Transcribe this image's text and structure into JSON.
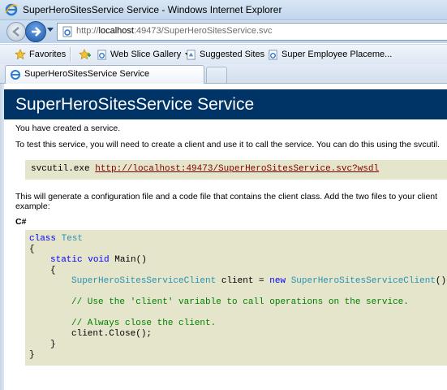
{
  "window": {
    "title": "SuperHeroSitesService Service - Windows Internet Explorer"
  },
  "address": {
    "prefix": "http://",
    "host": "localhost",
    "rest": ":49473/SuperHeroSitesService.svc"
  },
  "favorites_bar": {
    "favorites_label": "Favorites",
    "items": [
      {
        "label": "Web Slice Gallery",
        "icon": "web-slice-icon",
        "has_dropdown": true
      },
      {
        "label": "Suggested Sites",
        "icon": "suggested-sites-icon",
        "has_dropdown": true
      },
      {
        "label": "Super Employee Placeme...",
        "icon": "ie-page-icon",
        "has_dropdown": false
      }
    ]
  },
  "tabs": [
    {
      "label": "SuperHeroSitesService Service",
      "active": true
    }
  ],
  "page": {
    "heading": "SuperHeroSitesService Service",
    "created_msg": "You have created a service.",
    "test_msg": "To test this service, you will need to create a client and use it to call the service. You can do this using the svcutil.",
    "command": {
      "tool": "svcutil.exe",
      "url": "http://localhost:49473/SuperHeroSitesService.svc?wsdl"
    },
    "generate_msg_line1": "This will generate a configuration file and a code file that contains the client class. Add the two files to your client",
    "generate_msg_line2": "example:",
    "lang_label": "C#",
    "code": {
      "l1_kw": "class",
      "l1_cls": "Test",
      "l2": "{",
      "l3_kw1": "static",
      "l3_kw2": "void",
      "l3_rest": "Main()",
      "l4": "{",
      "l5_cls": "SuperHeroSitesServiceClient",
      "l5_mid": "client =",
      "l5_kw": "new",
      "l5_cls2": "SuperHeroSitesServiceClient",
      "l5_end": "();",
      "l6_cmt": "// Use the 'client' variable to call operations on the service.",
      "l7_cmt": "// Always close the client.",
      "l8": "client.Close();",
      "l9": "}",
      "l10": "}"
    }
  },
  "colors": {
    "heading_bg": "#003366",
    "code_bg": "#e5e5cc",
    "keyword": "#0000ff",
    "type": "#2b91af",
    "comment": "#008000",
    "link": "#800000"
  }
}
